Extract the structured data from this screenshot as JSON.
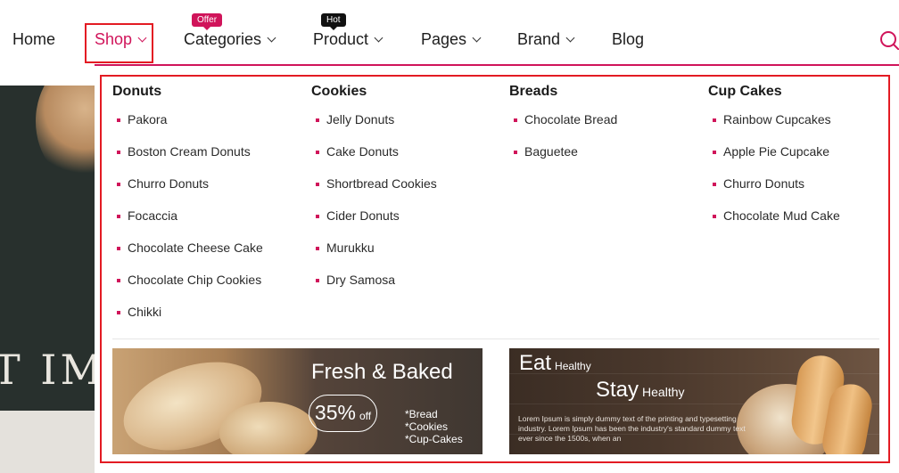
{
  "nav": {
    "items": [
      {
        "label": "Home"
      },
      {
        "label": "Shop",
        "active": true
      },
      {
        "label": "Categories",
        "badge": "Offer"
      },
      {
        "label": "Product",
        "badge": "Hot"
      },
      {
        "label": "Pages"
      },
      {
        "label": "Brand"
      },
      {
        "label": "Blog"
      }
    ],
    "icon": "search-icon"
  },
  "hero": {
    "text": "T IMI"
  },
  "mega_menu": {
    "columns": [
      {
        "title": "Donuts",
        "items": [
          "Pakora",
          "Boston Cream Donuts",
          "Churro Donuts",
          "Focaccia",
          "Chocolate Cheese Cake",
          "Chocolate Chip Cookies",
          "Chikki"
        ]
      },
      {
        "title": "Cookies",
        "items": [
          "Jelly Donuts",
          "Cake Donuts",
          "Shortbread Cookies",
          "Cider Donuts",
          "Murukku",
          "Dry Samosa"
        ]
      },
      {
        "title": "Breads",
        "items": [
          "Chocolate Bread",
          "Baguetee"
        ]
      },
      {
        "title": "Cup Cakes",
        "items": [
          "Rainbow Cupcakes",
          "Apple Pie Cupcake",
          "Churro Donuts",
          "Chocolate Mud Cake"
        ]
      }
    ],
    "banner_fresh": {
      "title": "Fresh & Baked",
      "percent": "35%",
      "off": "off",
      "list": [
        "*Bread",
        "*Cookies",
        "*Cup-Cakes"
      ]
    },
    "banner_eat": {
      "eat": "Eat",
      "eat_sub": "Healthy",
      "stay": "Stay",
      "stay_sub": "Healthy",
      "lorem": "Lorem Ipsum is simply dummy text of the printing and typesetting industry. Lorem Ipsum has been the industry's standard dummy text ever since the 1500s, when an"
    }
  },
  "colors": {
    "accent": "#d0145a",
    "highlight_frame": "#e31b23"
  }
}
